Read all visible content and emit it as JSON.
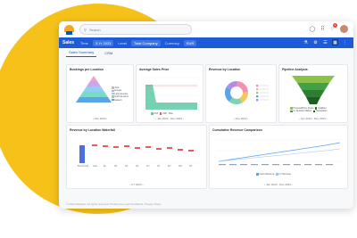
{
  "search": {
    "placeholder": "Search"
  },
  "topbar": {
    "notification_count": "2"
  },
  "filterbar": {
    "title": "Sales",
    "time_label": "Time",
    "time_value": "3-Yr 2023",
    "level_label": "Level",
    "level_value": "Total Company",
    "currency_label": "Currency",
    "currency_value": "EUR"
  },
  "tabs": [
    {
      "label": "Sales Summary"
    },
    {
      "label": "CRM"
    }
  ],
  "cards": {
    "bookings": {
      "title": "Bookings per Location",
      "footer": "Nov 2023",
      "legend": [
        "Asia",
        "Europe",
        "Latin America",
        "North America",
        "Eastern"
      ]
    },
    "price": {
      "title": "Average Sales Price",
      "footer": "Jan 2023 - Dec 2023",
      "legend": [
        "ASP",
        "ASP - Plan"
      ]
    },
    "revenue": {
      "title": "Revenue by Location",
      "footer": "Nov 2023"
    },
    "pipeline": {
      "title": "Pipeline Analysis",
      "footer": "Apr 2023 - Dec 2023",
      "legend": [
        "Proposal/Price Quote",
        "Id. Decision Makers",
        "Qualified",
        "Negotiation"
      ]
    },
    "waterfall": {
      "title": "Revenue by Location Waterfall",
      "footer": "FY 2023",
      "labels": [
        "Benchmark",
        "Asia",
        "Eu",
        "NA",
        "SA",
        "AS",
        "AU",
        "Afr",
        "EU",
        "AM",
        "NA",
        "Total"
      ]
    },
    "cumulative": {
      "title": "Cumulative Revenue Comparison",
      "footer": "Jan 2023 - Dec 2023",
      "legend": [
        "Cumul Revenue",
        "CY Revenue"
      ]
    }
  },
  "footer": "© 2023 Adaptive. All rights reserved. Preferences and Conditions. Privacy Policy"
}
